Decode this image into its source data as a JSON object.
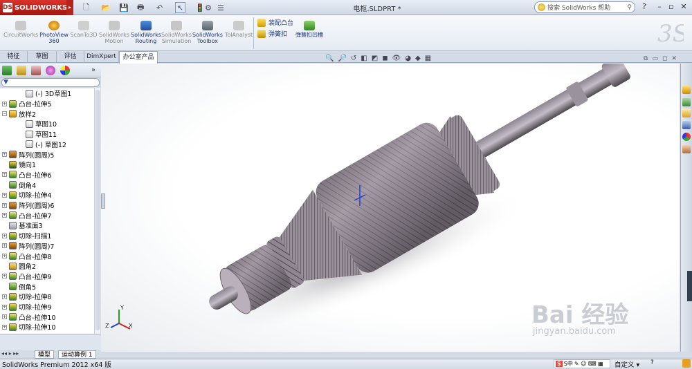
{
  "app": {
    "logo_text": "SOLIDWORKS",
    "doc_title": "电枢.SLDPRT *"
  },
  "search": {
    "placeholder": "搜索 SolidWorks 帮助"
  },
  "window_controls": [
    "?",
    "–",
    "▫",
    "✕"
  ],
  "command_manager": {
    "addins": [
      {
        "label": "CircuitWorks",
        "enabled": false
      },
      {
        "label": "PhotoView 360",
        "enabled": true
      },
      {
        "label": "ScanTo3D",
        "enabled": false
      },
      {
        "label": "SolidWorks Motion",
        "enabled": false
      },
      {
        "label": "SolidWorks Routing",
        "enabled": true
      },
      {
        "label": "SolidWorks Simulation",
        "enabled": false
      },
      {
        "label": "SolidWorks Toolbox",
        "enabled": true
      },
      {
        "label": "TolAnalyst",
        "enabled": false
      }
    ],
    "small_tools": [
      "装配凸台",
      "弹簧扣"
    ],
    "large_tool": "弹簧扣凹槽"
  },
  "tabs": [
    "特征",
    "草图",
    "评估",
    "DimXpert",
    "办公室产品"
  ],
  "active_tab": "办公室产品",
  "feature_tree": [
    {
      "label": "(-) 3D草图1",
      "indent": 2,
      "icon": "sketch3d",
      "toggle": ""
    },
    {
      "label": "凸台-拉伸5",
      "indent": 0,
      "icon": "extrude",
      "toggle": "+"
    },
    {
      "label": "放样2",
      "indent": 0,
      "icon": "loft",
      "toggle": "−"
    },
    {
      "label": "草图10",
      "indent": 2,
      "icon": "sketch",
      "toggle": ""
    },
    {
      "label": "草图11",
      "indent": 2,
      "icon": "sketch",
      "toggle": ""
    },
    {
      "label": "(-) 草图12",
      "indent": 2,
      "icon": "sketch",
      "toggle": ""
    },
    {
      "label": "阵列(圆周)5",
      "indent": 0,
      "icon": "pattern",
      "toggle": "+"
    },
    {
      "label": "镜向1",
      "indent": 0,
      "icon": "mirror",
      "toggle": ""
    },
    {
      "label": "凸台-拉伸6",
      "indent": 0,
      "icon": "extrude",
      "toggle": "+"
    },
    {
      "label": "倒角4",
      "indent": 0,
      "icon": "chamfer",
      "toggle": ""
    },
    {
      "label": "切除-拉伸4",
      "indent": 0,
      "icon": "cut",
      "toggle": "+"
    },
    {
      "label": "阵列(圆周)6",
      "indent": 0,
      "icon": "pattern",
      "toggle": "+"
    },
    {
      "label": "凸台-拉伸7",
      "indent": 0,
      "icon": "extrude",
      "toggle": "+"
    },
    {
      "label": "基准面3",
      "indent": 0,
      "icon": "plane",
      "toggle": ""
    },
    {
      "label": "切除-扫描1",
      "indent": 0,
      "icon": "cut",
      "toggle": "+"
    },
    {
      "label": "阵列(圆周)7",
      "indent": 0,
      "icon": "pattern",
      "toggle": "+"
    },
    {
      "label": "凸台-拉伸8",
      "indent": 0,
      "icon": "extrude",
      "toggle": "+"
    },
    {
      "label": "圆角2",
      "indent": 0,
      "icon": "fillet",
      "toggle": ""
    },
    {
      "label": "凸台-拉伸9",
      "indent": 0,
      "icon": "extrude",
      "toggle": "+"
    },
    {
      "label": "倒角5",
      "indent": 0,
      "icon": "chamfer",
      "toggle": ""
    },
    {
      "label": "切除-拉伸8",
      "indent": 0,
      "icon": "cut",
      "toggle": "+"
    },
    {
      "label": "切除-拉伸9",
      "indent": 0,
      "icon": "cut",
      "toggle": "+"
    },
    {
      "label": "凸台-拉伸10",
      "indent": 0,
      "icon": "extrude",
      "toggle": "+"
    },
    {
      "label": "切除-拉伸10",
      "indent": 0,
      "icon": "cut",
      "toggle": "+"
    }
  ],
  "bottom_tabs": [
    "模型",
    "运动算例 1"
  ],
  "triad": {
    "x": "X",
    "y": "Y",
    "z": "Z"
  },
  "status": {
    "text": "SolidWorks Premium 2012 x64 版",
    "custom": "自定义 ▾",
    "ime": "S中"
  },
  "watermark": {
    "brand": "Bai 经验",
    "url": "jingyan.baidu.com"
  }
}
